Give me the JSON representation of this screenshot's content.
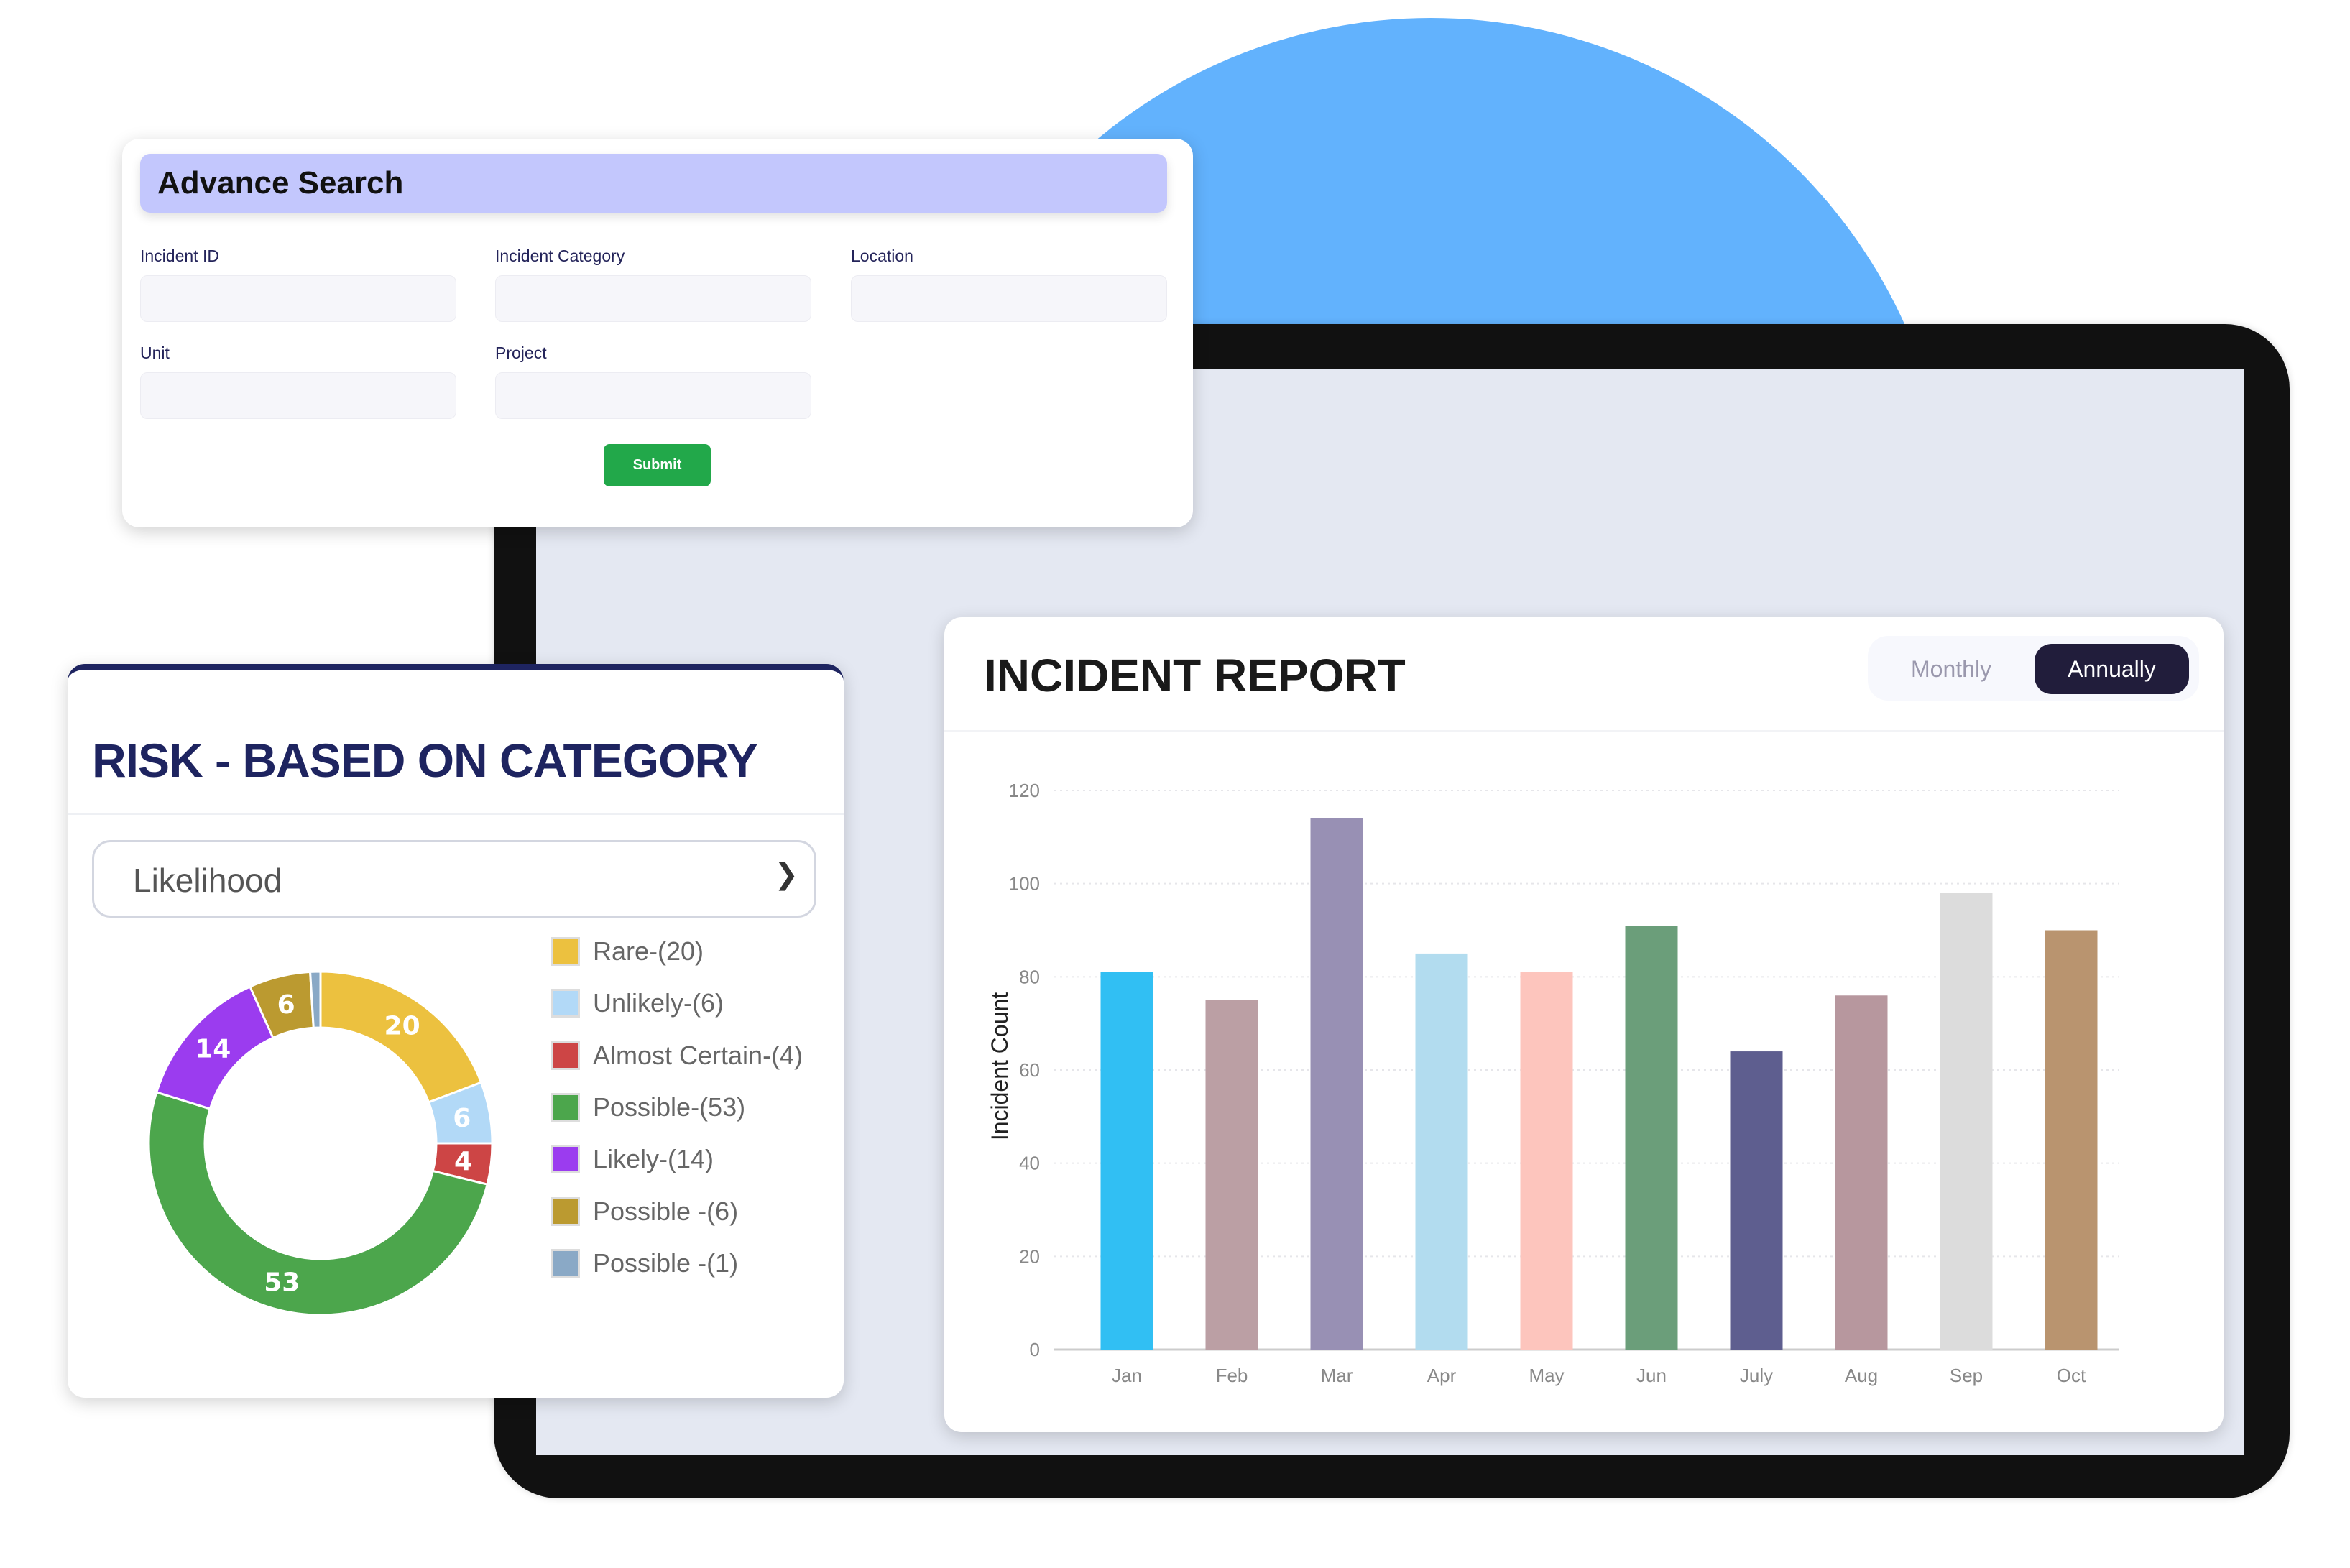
{
  "advance_search": {
    "title": "Advance Search",
    "fields": [
      {
        "label": "Incident ID",
        "value": ""
      },
      {
        "label": "Incident Category",
        "value": ""
      },
      {
        "label": "Location",
        "value": ""
      },
      {
        "label": "Unit",
        "value": ""
      },
      {
        "label": "Project",
        "value": ""
      }
    ],
    "submit_label": "Submit"
  },
  "risk": {
    "title": "RISK - BASED ON CATEGORY",
    "select_value": "Likelihood",
    "chevron_icon": "chevron-down-icon",
    "chart_data": {
      "type": "pie",
      "donut": true,
      "labels": [
        "Rare-(20)",
        "Unlikely-(6)",
        "Almost Certain-(4)",
        "Possible-(53)",
        "Likely-(14)",
        "Possible -(6)",
        "Possible -(1)"
      ],
      "values": [
        20,
        6,
        4,
        53,
        14,
        6,
        1
      ],
      "colors": [
        "#ecc13f",
        "#b2d9f7",
        "#cd4545",
        "#4ca64c",
        "#9b3cef",
        "#bb9a30",
        "#8aa9c6"
      ],
      "legend": "right"
    }
  },
  "report": {
    "title": "INCIDENT REPORT",
    "toggle": {
      "options": [
        "Monthly",
        "Annually"
      ],
      "selected": "Annually"
    },
    "chart_data": {
      "type": "bar",
      "categories": [
        "Jan",
        "Feb",
        "Mar",
        "Apr",
        "May",
        "Jun",
        "July",
        "Aug",
        "Sep",
        "Oct"
      ],
      "values": [
        81,
        75,
        114,
        85,
        81,
        91,
        64,
        76,
        98,
        90
      ],
      "colors": [
        "#31bff3",
        "#bb9fa4",
        "#9890b4",
        "#b2dcef",
        "#fdc5bd",
        "#6b9e7a",
        "#5e5e8f",
        "#b7979e",
        "#dcdcdc",
        "#b9946f"
      ],
      "ylabel": "Incident Count",
      "xlabel": "",
      "ylim": [
        0,
        120
      ],
      "yticks": [
        0,
        20,
        40,
        60,
        80,
        100,
        120
      ],
      "grid": true
    }
  }
}
